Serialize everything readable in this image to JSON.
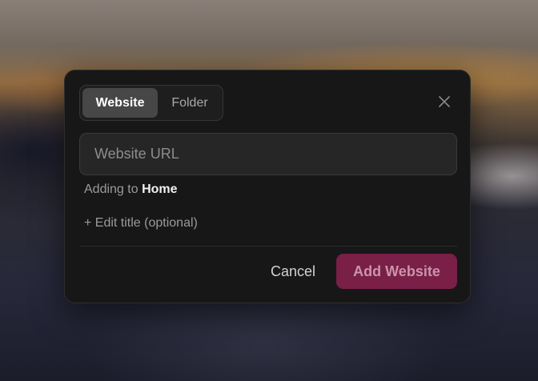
{
  "tabs": [
    {
      "label": "Website",
      "active": true
    },
    {
      "label": "Folder",
      "active": false
    }
  ],
  "close": {
    "icon": "close-icon"
  },
  "url_input": {
    "placeholder": "Website URL",
    "value": ""
  },
  "destination": {
    "prefix": "Adding to",
    "name": "Home"
  },
  "edit_title": {
    "label": "+ Edit title (optional)"
  },
  "footer": {
    "cancel_label": "Cancel",
    "submit_label": "Add Website"
  },
  "colors": {
    "dialog_bg": "#171717",
    "primary_button_bg": "#7a1f47",
    "primary_button_text": "#c995ac"
  }
}
